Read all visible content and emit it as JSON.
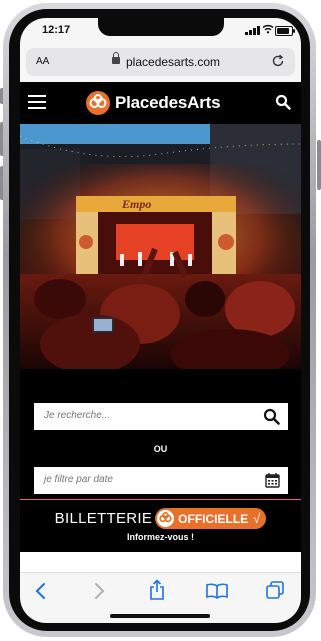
{
  "status_bar": {
    "time": "12:17"
  },
  "browser": {
    "text_size_label": "AA",
    "url": "placedesarts.com"
  },
  "site": {
    "logo_text": "PlacedesArts",
    "brand_color": "#e8702a",
    "hero_stage_sign": "Empo"
  },
  "search": {
    "keyword_placeholder": "Je recherche...",
    "or_label": "OU",
    "date_placeholder": "je filtre par date"
  },
  "ticketing": {
    "word": "BILLETTERIE",
    "badge": "OFFICIELLE",
    "check": "√",
    "subtitle": "Informez-vous !"
  },
  "icons": {
    "toolbar": [
      "back-icon",
      "forward-icon",
      "share-icon",
      "bookmarks-icon",
      "tabs-icon"
    ]
  }
}
